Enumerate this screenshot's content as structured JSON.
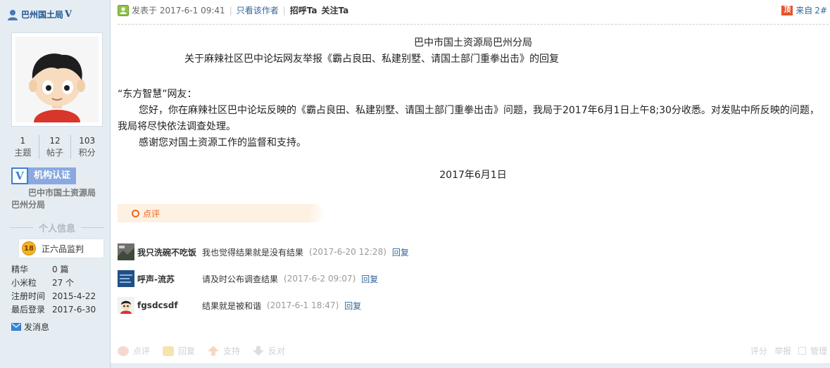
{
  "author": {
    "name": "巴州国土局",
    "verified_mark": "V",
    "stats": [
      {
        "num": "1",
        "label": "主题"
      },
      {
        "num": "12",
        "label": "帖子"
      },
      {
        "num": "103",
        "label": "积分"
      }
    ],
    "cert_badge": "V",
    "cert_label": "机构认证",
    "org": "巴中市国土资源局巴州分局",
    "section_title": "个人信息",
    "medal_num": "18",
    "medal_label": "正六品监判",
    "info": [
      {
        "key": "精华",
        "value": "0 篇"
      },
      {
        "key": "小米粒",
        "value": "27 个"
      },
      {
        "key": "注册时间",
        "value": "2015-4-22"
      },
      {
        "key": "最后登录",
        "value": "2017-6-30"
      }
    ],
    "message_link": "发消息"
  },
  "post": {
    "posted": "发表于 2017-6-1 09:41",
    "only_author": "只看该作者",
    "greet": "招呼Ta",
    "follow": "关注Ta",
    "floor_from": "来自",
    "floor_num": "2#",
    "top_icon": "顶",
    "content": {
      "title1": "巴中市国土资源局巴州分局",
      "title2": "关于麻辣社区巴中论坛网友举报《霸占良田、私建别墅、请国土部门重拳出击》的回复",
      "salutation": "“东方智慧”网友：",
      "para1": "您好，你在麻辣社区巴中论坛反映的《霸占良田、私建别墅、请国土部门重拳出击》问题，我局于2017年6月1日上午8;30分收悉。对发贴中所反映的问题，我局将尽快依法调查处理。",
      "para2": "感谢您对国土资源工作的监督和支持。",
      "date": "2017年6月1日"
    },
    "comment_bar_label": "点评",
    "comments": [
      {
        "name": "我只洗碗不吃饭",
        "text": "我也觉得结果就是没有结果",
        "time": "(2017-6-20 12:28)",
        "reply": "回复"
      },
      {
        "name": "呼声-流苏",
        "text": "请及时公布调查结果",
        "time": "(2017-6-2 09:07)",
        "reply": "回复"
      },
      {
        "name": "fgsdcsdf",
        "text": "结果就是被和谐",
        "time": "(2017-6-1 18:47)",
        "reply": "回复"
      }
    ],
    "actions": [
      "点评",
      "回复",
      "支持",
      "反对"
    ],
    "actions_right": [
      "评分",
      "举报",
      "管理"
    ]
  }
}
